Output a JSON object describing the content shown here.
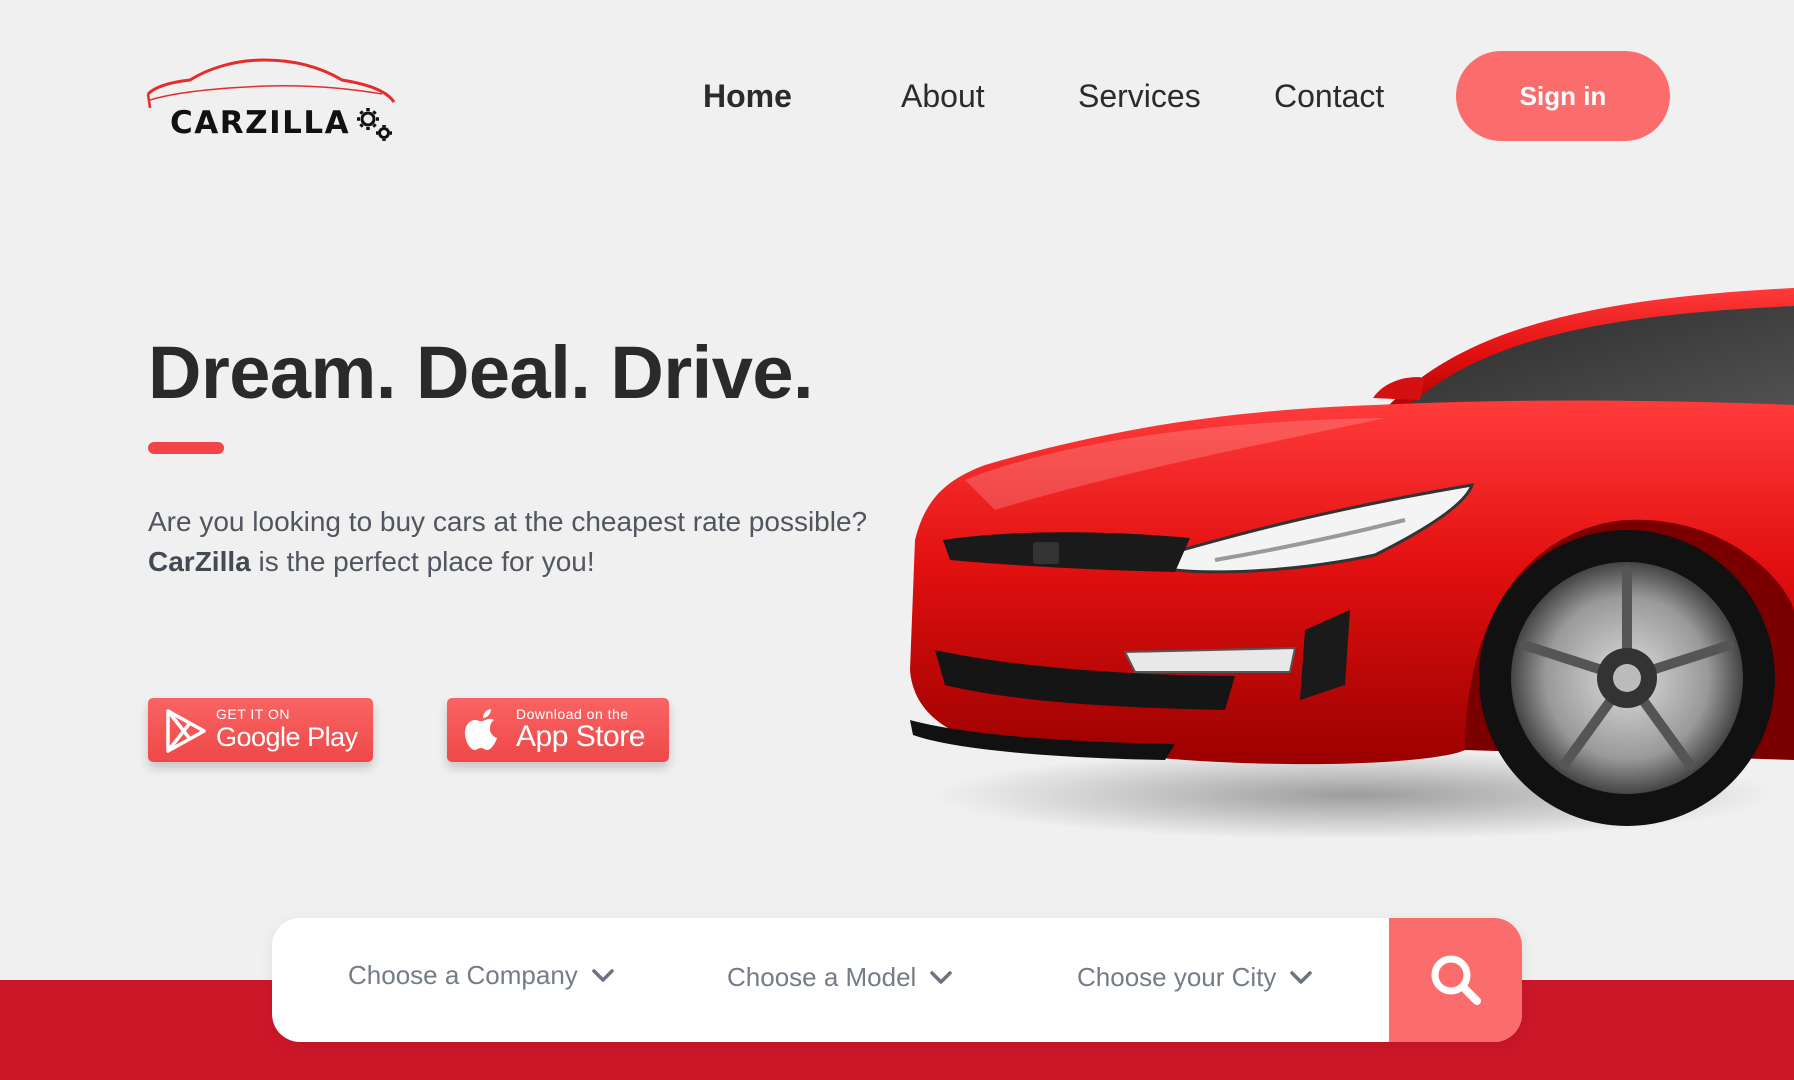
{
  "brand": {
    "logo_text": "CARZILLA"
  },
  "nav": {
    "items": [
      {
        "label": "Home",
        "active": true
      },
      {
        "label": "About",
        "active": false
      },
      {
        "label": "Services",
        "active": false
      },
      {
        "label": "Contact",
        "active": false
      }
    ],
    "signin_label": "Sign in"
  },
  "hero": {
    "title": "Dream. Deal. Drive.",
    "line1": "Are you looking to buy cars at the cheapest rate possible?",
    "brand_name": "CarZilla",
    "line2_rest": " is the perfect place for you!"
  },
  "stores": {
    "google": {
      "small": "GET IT ON",
      "big": "Google Play",
      "icon": "google-play-icon"
    },
    "apple": {
      "small": "Download on the",
      "big": "App Store",
      "icon": "apple-icon"
    }
  },
  "search": {
    "company_placeholder": "Choose a Company",
    "model_placeholder": "Choose a Model",
    "city_placeholder": "Choose your City",
    "icon": "search-icon"
  },
  "colors": {
    "accent": "#fb6d6c",
    "underline": "#f24448",
    "band": "#cc1729",
    "background": "#f0f0f0"
  }
}
